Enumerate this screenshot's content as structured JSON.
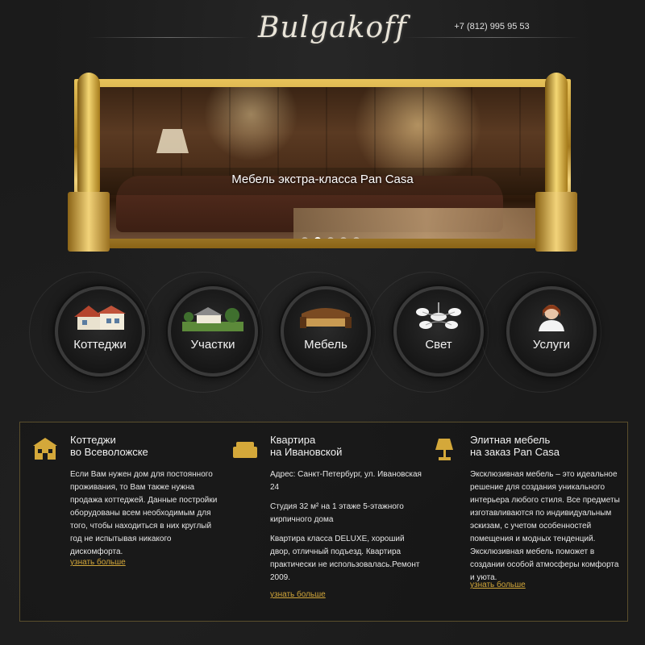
{
  "header": {
    "logo": "Bulgakoff",
    "phone": "+7 (812) 995 95 53"
  },
  "banner": {
    "caption": "Мебель экстра-класса Pan Casa",
    "slide_count": 5,
    "active_slide": 2
  },
  "categories": [
    {
      "label": "Коттеджи",
      "icon": "cottage-icon"
    },
    {
      "label": "Участки",
      "icon": "land-plot-icon"
    },
    {
      "label": "Мебель",
      "icon": "sofa-icon"
    },
    {
      "label": "Свет",
      "icon": "chandelier-icon"
    },
    {
      "label": "Услуги",
      "icon": "operator-icon"
    }
  ],
  "columns": [
    {
      "icon": "house-icon",
      "title_line1": "Коттеджи",
      "title_line2": "во Всеволожске",
      "paragraphs": [
        "Если Вам нужен дом для постоянного проживания, то Вам также нужна продажа коттеджей. Данные постройки оборудованы всем необходимым для того, чтобы находиться в них круглый год не испытывая никакого дискомфорта."
      ],
      "more": "узнать больше"
    },
    {
      "icon": "sofa-icon",
      "title_line1": "Квартира",
      "title_line2": "на Ивановской",
      "paragraphs": [
        "Адрес: Санкт-Петербург, ул. Ивановская 24",
        "Студия 32 м² на 1 этаже 5-этажного кирпичного дома",
        "Квартира класса DELUXE, хороший двор, отличный подъезд. Квартира практически не использовалась.Ремонт 2009."
      ],
      "more": "узнать больше"
    },
    {
      "icon": "lamp-icon",
      "title_line1": "Элитная мебель",
      "title_line2": "на заказ Pan Casa",
      "paragraphs": [
        "Эксклюзивная мебель – это идеальное решение для создания уникального интерьера любого стиля. Все предметы изготавливаются по индивидуальным эскизам, с учетом особенностей помещения и модных тенденций. Эксклюзивная мебель поможет в создании особой атмосферы комфорта и уюта."
      ],
      "more": "узнать больше"
    }
  ],
  "colors": {
    "gold": "#d4a83a",
    "background": "#1b1b1b"
  }
}
